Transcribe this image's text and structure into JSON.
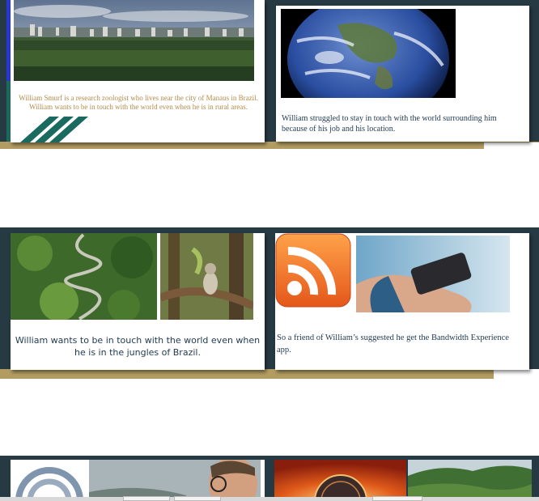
{
  "slides": [
    {
      "id": "slide-1",
      "caption": "William Smurf is a research zoologist who lives near the city of Manaus in Brazil. William wants to be in touch with the world even when he is in rural areas.",
      "image": "manaus-city-aerial-photo"
    },
    {
      "id": "slide-2",
      "caption": "William struggled to stay in touch with the  world surrounding him because of his job and his location.",
      "image": "earth-globe-photo"
    },
    {
      "id": "slide-3",
      "caption": "William wants to be in touch with the world even when he is in the jungles of Brazil.",
      "images": [
        "jungle-road-aerial-photo",
        "monkey-in-tree-photo"
      ]
    },
    {
      "id": "slide-4",
      "caption": "So a friend of William’s suggested he get the Bandwidth Experience app.",
      "images": [
        "rss-feed-icon",
        "hand-holding-smartphone-photo"
      ]
    },
    {
      "id": "slide-5",
      "images": [
        "wifi-signal-icon",
        "man-with-glasses-photo"
      ]
    },
    {
      "id": "slide-6",
      "images": [
        "data-tunnel-photo",
        "green-hills-photo"
      ]
    }
  ],
  "colors": {
    "panel": "#263a44",
    "gold": "#b39c62",
    "teal": "#1b6a60",
    "caption_gold": "#b58a4a",
    "caption_blue": "#1f3a4f",
    "accent_blue": "#2a36d8"
  }
}
